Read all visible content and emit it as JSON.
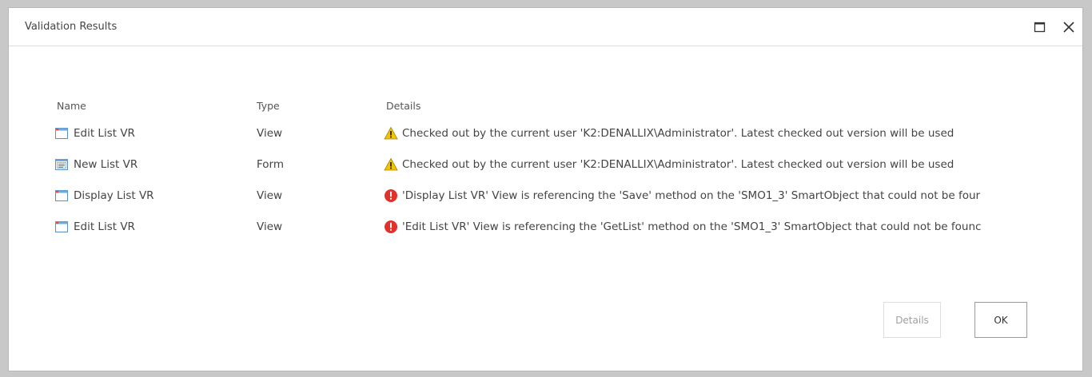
{
  "dialog": {
    "title": "Validation Results",
    "maximize_icon": "maximize-icon",
    "close_icon": "close-icon"
  },
  "table": {
    "columns": [
      "Name",
      "Type",
      "Details"
    ],
    "rows": [
      {
        "item_icon": "view-icon",
        "name": "Edit List VR",
        "type": "View",
        "status_icon": "warning-icon",
        "details": "Checked out by the current user 'K2:DENALLIX\\Administrator'. Latest checked out version will be used"
      },
      {
        "item_icon": "form-icon",
        "name": "New List VR",
        "type": "Form",
        "status_icon": "warning-icon",
        "details": "Checked out by the current user 'K2:DENALLIX\\Administrator'. Latest checked out version will be used"
      },
      {
        "item_icon": "view-icon",
        "name": "Display List VR",
        "type": "View",
        "status_icon": "error-icon",
        "details": "'Display List VR' View is referencing the 'Save' method on the 'SMO1_3' SmartObject that could not be four"
      },
      {
        "item_icon": "view-icon",
        "name": "Edit List VR",
        "type": "View",
        "status_icon": "error-icon",
        "details": "'Edit List VR' View is referencing the 'GetList' method on the 'SMO1_3' SmartObject that could not be founc"
      }
    ]
  },
  "buttons": {
    "details_label": "Details",
    "ok_label": "OK"
  },
  "colors": {
    "warning": "#f5c400",
    "error": "#e0312b",
    "view_icon_header": "#6fa8dc"
  }
}
